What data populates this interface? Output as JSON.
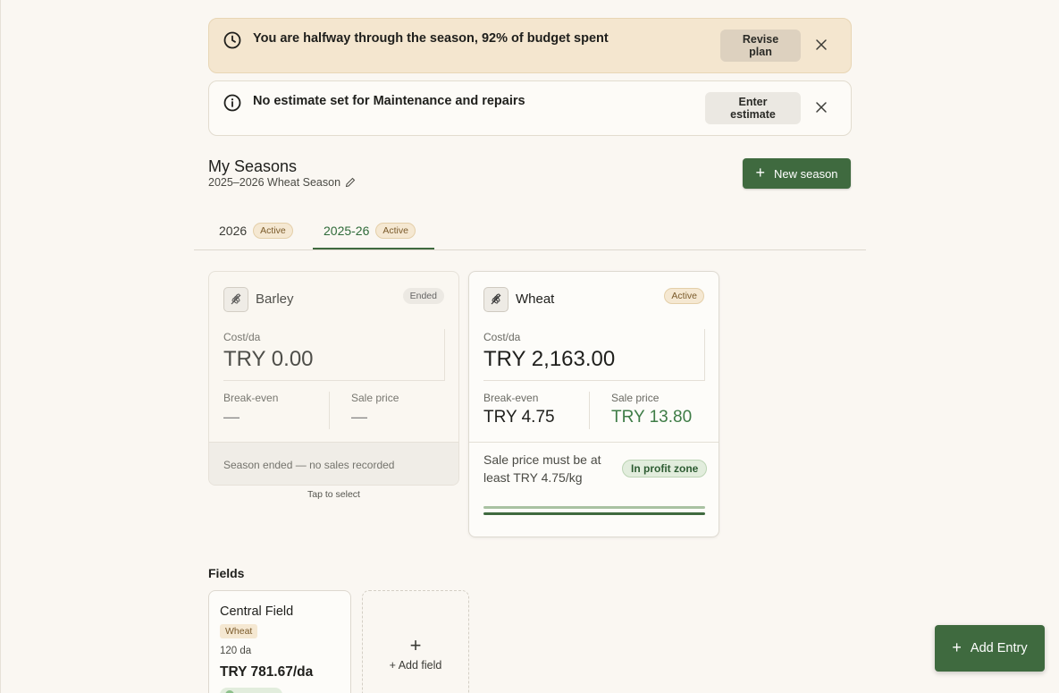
{
  "banners": {
    "budget": {
      "text": "You are halfway through the season, 92% of budget spent",
      "button": "Revise plan"
    },
    "estimate": {
      "text": "No estimate set for Maintenance and repairs",
      "button": "Enter estimate"
    }
  },
  "header": {
    "title": "My Seasons",
    "subtitle": "2025–2026 Wheat Season",
    "new_season": "New season"
  },
  "tabs": [
    {
      "label": "2026",
      "badge": "Active"
    },
    {
      "label": "2025-26",
      "badge": "Active"
    }
  ],
  "crops": {
    "barley": {
      "name": "Barley",
      "status": "Ended",
      "cost_label": "Cost/da",
      "cost": "TRY 0.00",
      "break_even_label": "Break-even",
      "break_even": "—",
      "sale_label": "Sale price",
      "sale": "—",
      "footer": "Season ended — no sales recorded",
      "hint": "Tap to select"
    },
    "wheat": {
      "name": "Wheat",
      "status": "Active",
      "cost_label": "Cost/da",
      "cost": "TRY 2,163.00",
      "break_even_label": "Break-even",
      "break_even": "TRY 4.75",
      "sale_label": "Sale price",
      "sale": "TRY 13.80",
      "footer": "Sale price must be at least TRY 4.75/kg",
      "zone": "In profit zone"
    }
  },
  "fields": {
    "title": "Fields",
    "items": [
      {
        "name": "Central Field",
        "crop": "Wheat",
        "area": "120 da",
        "cost": "TRY 781.67/da"
      }
    ],
    "add_label": "+ Add field"
  },
  "fab": {
    "label": "Add Entry"
  },
  "colors": {
    "primary": "#3f6a3f",
    "warn_bg": "#f4e6cf",
    "profit_green": "#3e7c46",
    "background": "#faf7f2"
  },
  "icons": [
    "clock-icon",
    "info-icon",
    "close-icon",
    "pencil-icon",
    "plus-icon",
    "wheat-icon"
  ]
}
